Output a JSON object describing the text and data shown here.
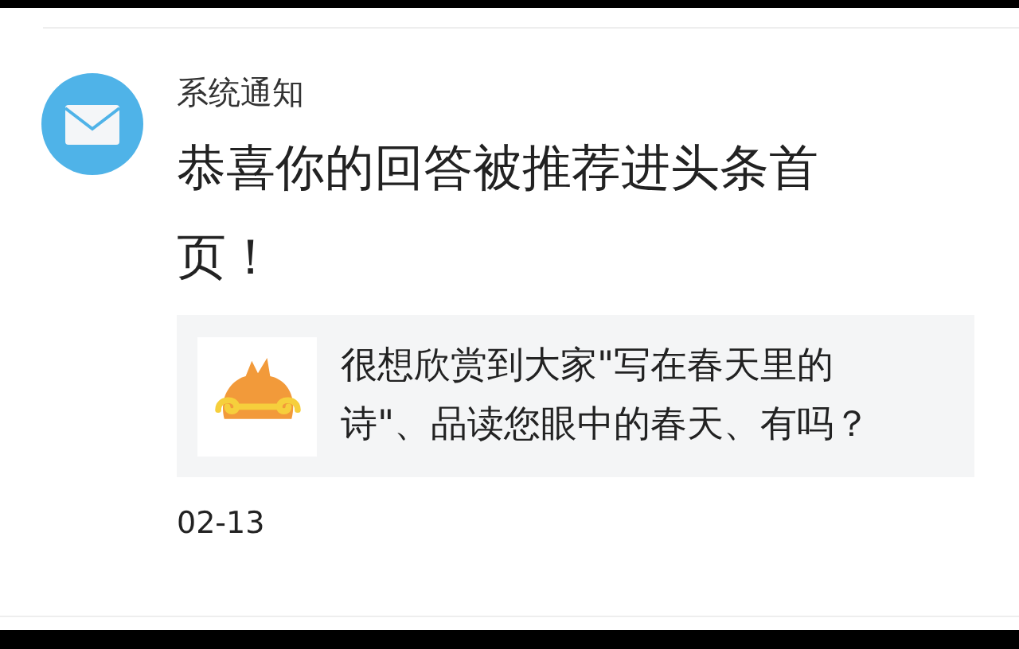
{
  "notification": {
    "sender": "系统通知",
    "title": "恭喜你的回答被推荐进头条首页！",
    "card": {
      "text": "很想欣赏到大家\"写在春天里的诗\"、品读您眼中的春天、有吗？"
    },
    "date": "02-13"
  }
}
